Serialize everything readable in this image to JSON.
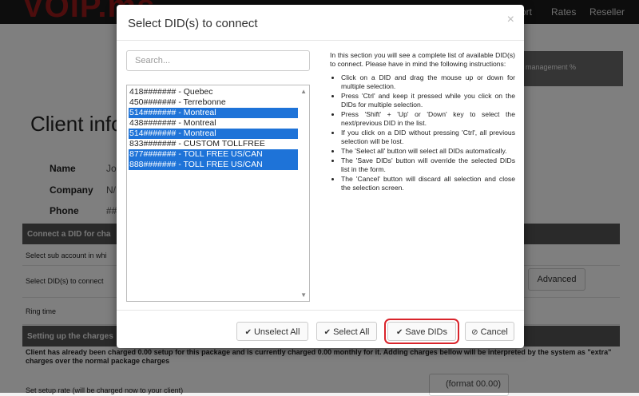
{
  "background": {
    "logo_text": "VOIP.ms",
    "nav": [
      "ort",
      "Rates",
      "Reseller"
    ],
    "panel_text": "management %",
    "client_title": "Client info",
    "fields": [
      {
        "label": "Name",
        "value": "Jo"
      },
      {
        "label": "Company",
        "value": "N/"
      },
      {
        "label": "Phone",
        "value": "##"
      }
    ],
    "section_connect": "Connect a DID for cha",
    "row_sub_account": "Select sub account in whi",
    "row_select_dids": "Select DID(s) to connect",
    "row_ring_time": "Ring time",
    "advanced_label": "Advanced",
    "section_charges": "Setting up the charges",
    "notice": "Client has already been charged 0.00 setup for this package and is currently charged 0.00 monthly for it. Adding charges bellow will be interpreted by the system as \"extra\" charges over the normal package charges",
    "setup_label": "Set setup rate (will be charged now to your client)",
    "format_hint": "(format 00.00)"
  },
  "modal": {
    "title": "Select DID(s) to connect",
    "close_glyph": "×",
    "search_placeholder": "Search...",
    "dids": [
      {
        "label": "418####### - Quebec",
        "selected": false
      },
      {
        "label": "450####### - Terrebonne",
        "selected": false
      },
      {
        "label": "514####### - Montreal",
        "selected": true
      },
      {
        "label": "438####### - Montreal",
        "selected": false
      },
      {
        "label": "514####### - Montreal",
        "selected": true
      },
      {
        "label": "833####### - CUSTOM TOLLFREE",
        "selected": false
      },
      {
        "label": "877####### - TOLL FREE US/CAN",
        "selected": true
      },
      {
        "label": "888####### - TOLL FREE US/CAN",
        "selected": true
      }
    ],
    "intro": "In this section you will see a complete list of available DID(s) to connect. Please have in mind the following instructions:",
    "instructions": [
      "Click on a DID and drag the mouse up or down for multiple selection.",
      "Press 'Ctrl' and keep it pressed while you click on the DIDs for multiple selection.",
      "Press 'Shift' + 'Up' or 'Down' key to select the next/previous DID in the list.",
      "If you click on a DID without pressing 'Ctrl', all previous selection will be lost.",
      "The 'Select all' button will select all DIDs automatically.",
      "The 'Save DIDs' button will override the selected DIDs list in the form.",
      "The 'Cancel' button will discard all selection and close the selection screen."
    ],
    "buttons": {
      "unselect_all": "Unselect All",
      "select_all": "Select All",
      "save_dids": "Save DIDs",
      "cancel": "Cancel"
    },
    "icons": {
      "check": "✔",
      "cancel": "⊘"
    },
    "colors": {
      "selection": "#1e73d8",
      "highlight_border": "#d9242b"
    }
  }
}
